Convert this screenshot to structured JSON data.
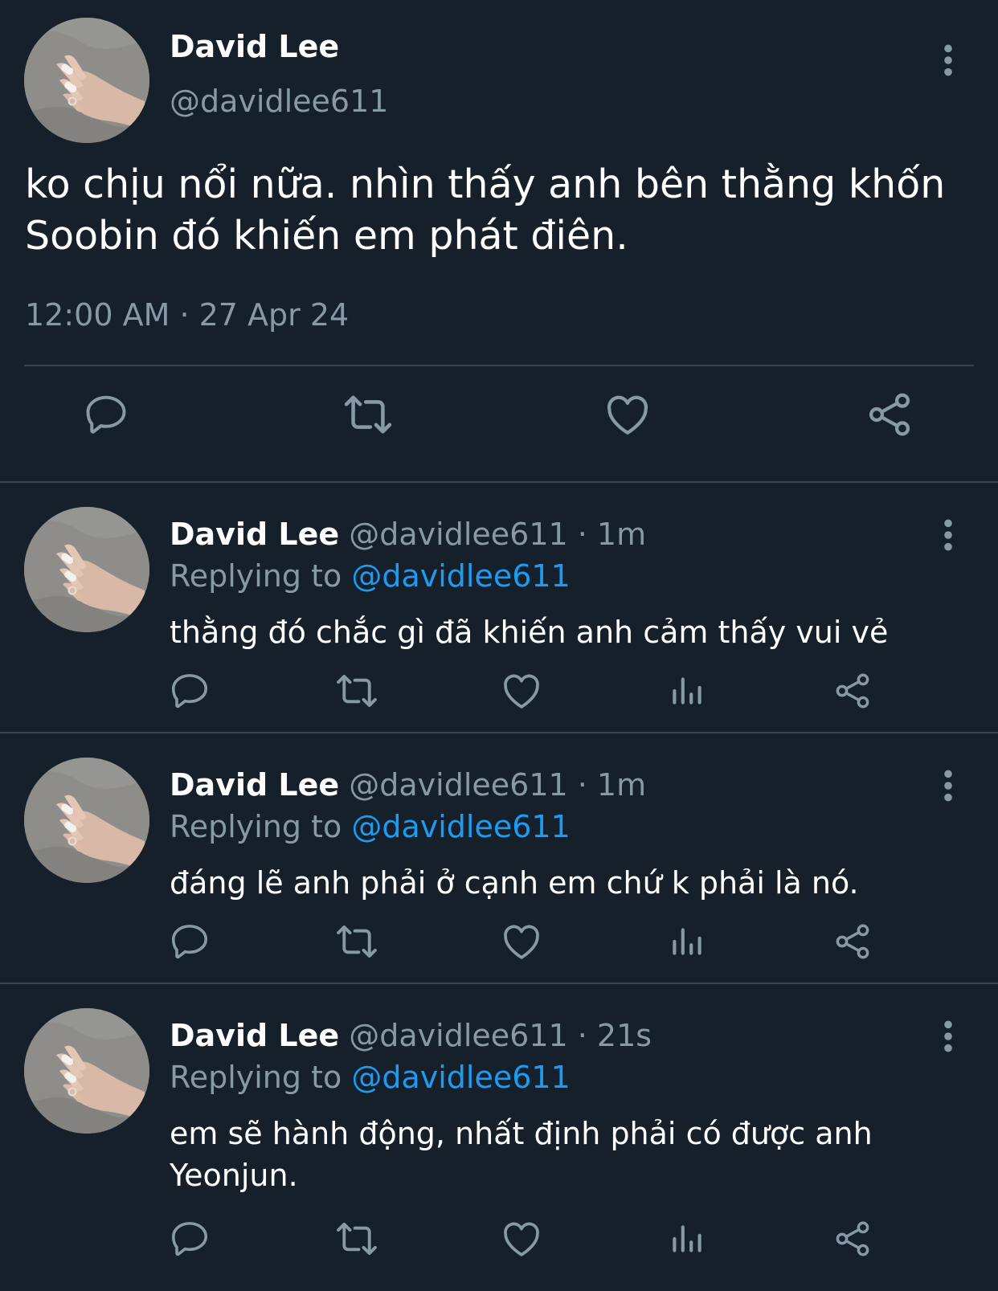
{
  "main_tweet": {
    "name": "David Lee",
    "handle": "@davidlee611",
    "text": "ko chịu nổi nữa. nhìn thấy anh bên thằng khốn Soobin đó khiến em phát điên.",
    "timestamp": "12:00 AM · 27 Apr 24",
    "actions": [
      "reply-icon",
      "retweet-icon",
      "like-icon",
      "share-icon"
    ]
  },
  "replies": [
    {
      "name": "David Lee",
      "handle_time": "@davidlee611 · 1m",
      "replying_label": "Replying to",
      "replying_to": "@davidlee611",
      "text": "thằng đó chắc gì đã khiến anh cảm thấy vui vẻ"
    },
    {
      "name": "David Lee",
      "handle_time": "@davidlee611 · 1m",
      "replying_label": "Replying to",
      "replying_to": "@davidlee611",
      "text": "đáng lẽ anh phải ở cạnh em chứ k phải là nó."
    },
    {
      "name": "David Lee",
      "handle_time": "@davidlee611 · 21s",
      "replying_label": "Replying to",
      "replying_to": "@davidlee611",
      "text": "em sẽ hành động, nhất định phải có được anh Yeonjun."
    }
  ],
  "colors": {
    "background": "#15202b",
    "divider": "#38444d",
    "secondary_text": "#8899a6",
    "accent": "#1d9bf0"
  }
}
